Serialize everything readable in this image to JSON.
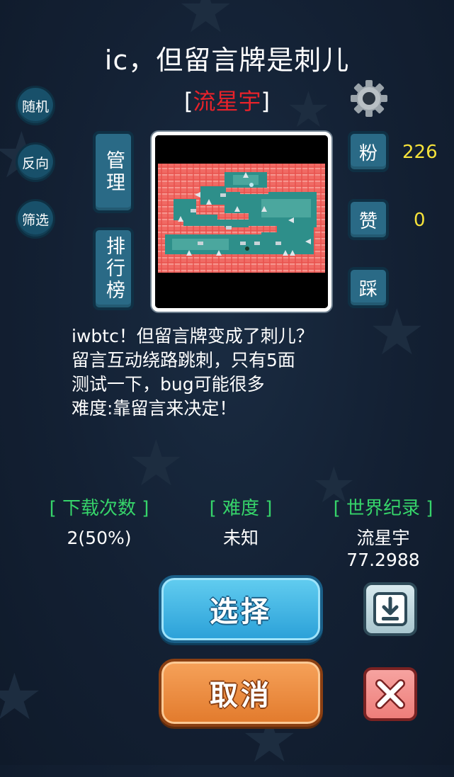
{
  "level": {
    "title": "ic，但留言牌是刺儿",
    "author_open": "[",
    "author": "流星宇",
    "author_close": "]",
    "description": [
      "iwbtc！但留言牌变成了刺儿？",
      "留言互动绕路跳刺，只有5面",
      "测试一下，bug可能很多",
      "难度:靠留言来决定！"
    ]
  },
  "side_buttons": {
    "random": "随机",
    "reverse": "反向",
    "filter": "筛选"
  },
  "center_buttons": {
    "manage": "管理",
    "ranking": "排行榜"
  },
  "stats_right": {
    "fans_label": "粉",
    "fans_value": "226",
    "like_label": "赞",
    "like_value": "0",
    "dislike_label": "踩"
  },
  "stats_bottom": {
    "downloads_header": "[ 下载次数 ]",
    "downloads_value": "2(50%)",
    "difficulty_header": "[ 难度 ]",
    "difficulty_value": "未知",
    "record_header": "[ 世界纪录 ]",
    "record_holder": "流星宇",
    "record_time": "77.2988"
  },
  "actions": {
    "select": "选择",
    "cancel": "取消"
  },
  "icons": {
    "settings": "gear-icon",
    "download": "download-icon",
    "close": "close-icon"
  },
  "colors": {
    "author": "#e8222a",
    "stat_value": "#f5e23a",
    "stat_header": "#36d46a",
    "select_button": "#2aa0d8",
    "cancel_button": "#e27a2c"
  }
}
